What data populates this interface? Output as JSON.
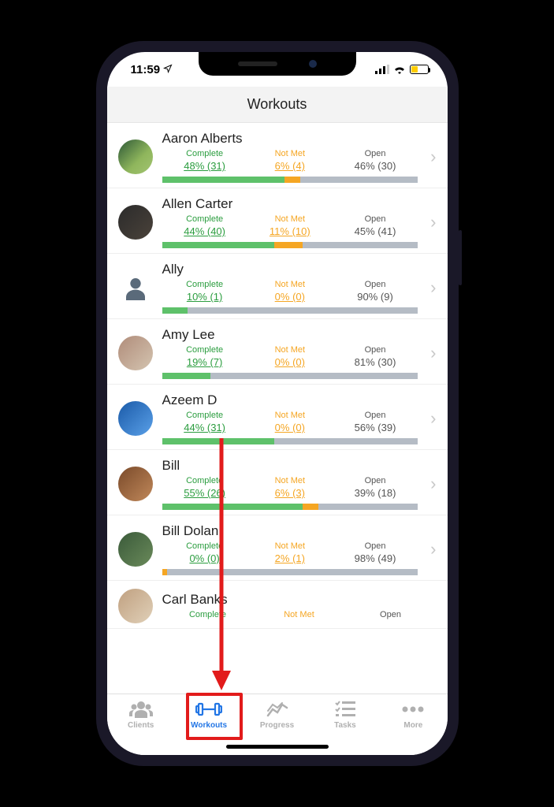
{
  "status": {
    "time": "11:59"
  },
  "header": {
    "title": "Workouts"
  },
  "labels": {
    "complete": "Complete",
    "notmet": "Not Met",
    "open": "Open"
  },
  "clients": [
    {
      "name": "Aaron Alberts",
      "complete": "48% (31)",
      "notmet": "6% (4)",
      "open": "46% (30)",
      "c": 48,
      "n": 6
    },
    {
      "name": "Allen Carter",
      "complete": "44% (40)",
      "notmet": "11% (10)",
      "open": "45% (41)",
      "c": 44,
      "n": 11
    },
    {
      "name": "Ally",
      "complete": "10% (1)",
      "notmet": "0% (0)",
      "open": "90% (9)",
      "c": 10,
      "n": 0
    },
    {
      "name": "Amy Lee",
      "complete": "19% (7)",
      "notmet": "0% (0)",
      "open": "81% (30)",
      "c": 19,
      "n": 0
    },
    {
      "name": "Azeem D",
      "complete": "44% (31)",
      "notmet": "0% (0)",
      "open": "56% (39)",
      "c": 44,
      "n": 0
    },
    {
      "name": "Bill",
      "complete": "55% (26)",
      "notmet": "6% (3)",
      "open": "39% (18)",
      "c": 55,
      "n": 6
    },
    {
      "name": "Bill Dolan",
      "complete": "0% (0)",
      "notmet": "2% (1)",
      "open": "98% (49)",
      "c": 0,
      "n": 2
    },
    {
      "name": "Carl Banks",
      "complete": "",
      "notmet": "Not Met",
      "open": "Open",
      "c": 0,
      "n": 0
    }
  ],
  "tabs": {
    "clients": "Clients",
    "workouts": "Workouts",
    "progress": "Progress",
    "tasks": "Tasks",
    "more": "More"
  },
  "annotation": {
    "arrow_target": "workouts-tab"
  }
}
